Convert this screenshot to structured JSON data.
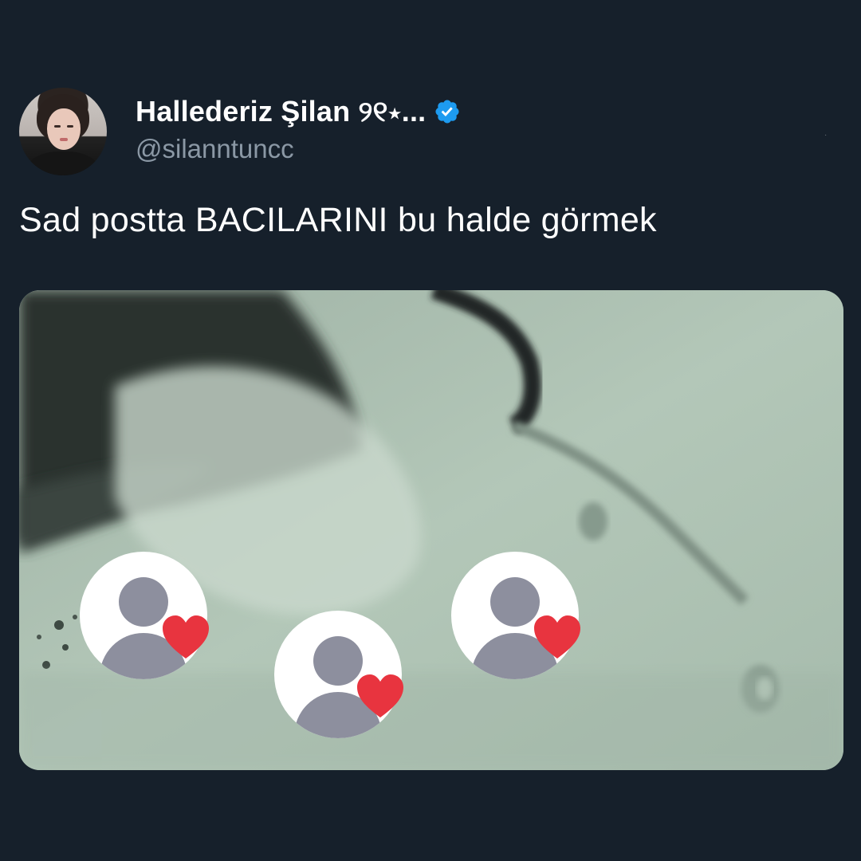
{
  "author": {
    "display_name": "Hallederiz Şilan ୨୧⋆...",
    "username": "@silanntuncc",
    "verified": true,
    "avatar_icon": "profile-photo-avatar"
  },
  "tweet": {
    "text": "Sad postta BACILARINI bu halde görmek"
  },
  "media": {
    "reactions": [
      {
        "icon": "default-profile-icon",
        "badge": "heart-icon"
      },
      {
        "icon": "default-profile-icon",
        "badge": "heart-icon"
      },
      {
        "icon": "default-profile-icon",
        "badge": "heart-icon"
      }
    ]
  },
  "colors": {
    "background": "#16202b",
    "verified": "#1d9bf0",
    "heart": "#e8343f",
    "username": "#8b98a5"
  }
}
